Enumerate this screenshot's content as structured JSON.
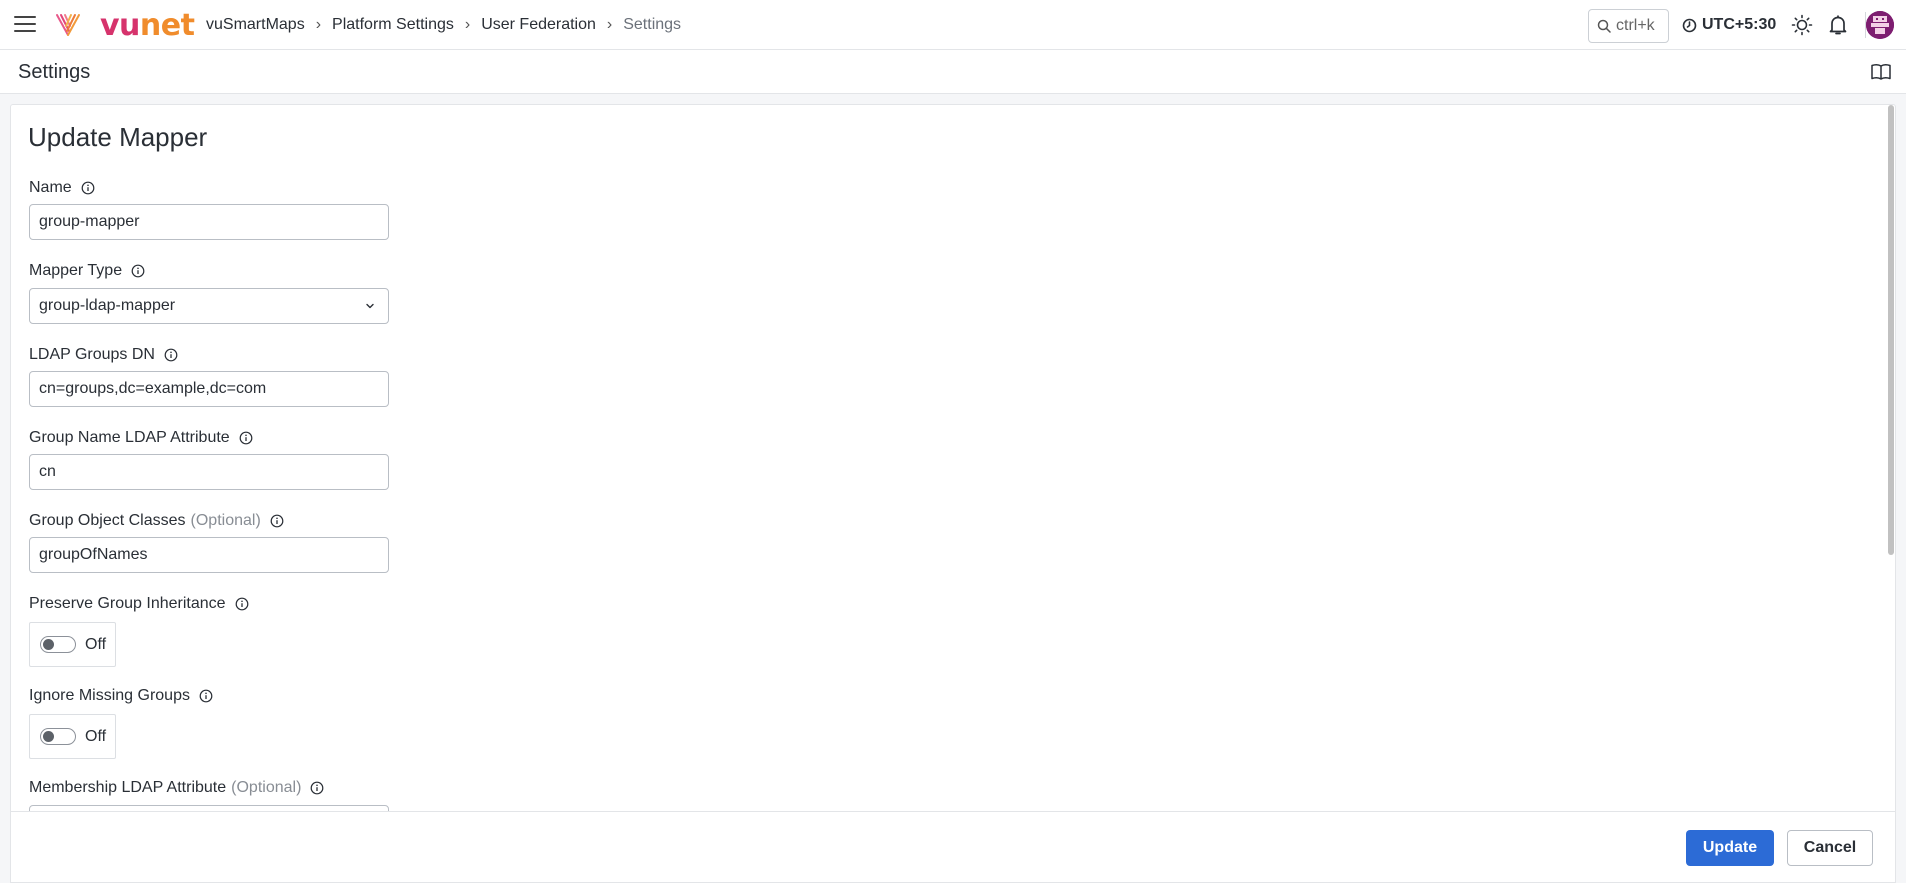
{
  "header": {
    "logo": {
      "part1": "vu",
      "part2": "net"
    },
    "breadcrumb": [
      "vuSmartMaps",
      "Platform Settings",
      "User Federation",
      "Settings"
    ],
    "search_placeholder": "ctrl+k",
    "timezone": "UTC+5:30",
    "icons": [
      "menu-icon",
      "search-icon",
      "clock-icon",
      "sun-icon",
      "bell-icon",
      "avatar"
    ]
  },
  "subheader": {
    "title": "Settings",
    "icon": "book-icon"
  },
  "form": {
    "title": "Update Mapper",
    "fields": [
      {
        "label": "Name",
        "value": "group-mapper"
      },
      {
        "label": "Mapper Type",
        "value": "group-ldap-mapper",
        "type": "select"
      },
      {
        "label": "LDAP Groups DN",
        "value": "cn=groups,dc=example,dc=com"
      },
      {
        "label": "Group Name LDAP Attribute",
        "value": "cn"
      },
      {
        "label": "Group Object Classes",
        "optional": "(Optional)",
        "value": "groupOfNames"
      }
    ],
    "toggles": [
      {
        "label": "Preserve Group Inheritance",
        "state": "Off"
      },
      {
        "label": "Ignore Missing Groups",
        "state": "Off"
      }
    ],
    "last_field": {
      "label": "Membership LDAP Attribute",
      "optional": "(Optional)"
    }
  },
  "footer": {
    "update_label": "Update",
    "cancel_label": "Cancel"
  },
  "colors": {
    "primary": "#2c6bd6",
    "brand_vu": "#d6336c",
    "brand_net": "#f08c2c"
  }
}
